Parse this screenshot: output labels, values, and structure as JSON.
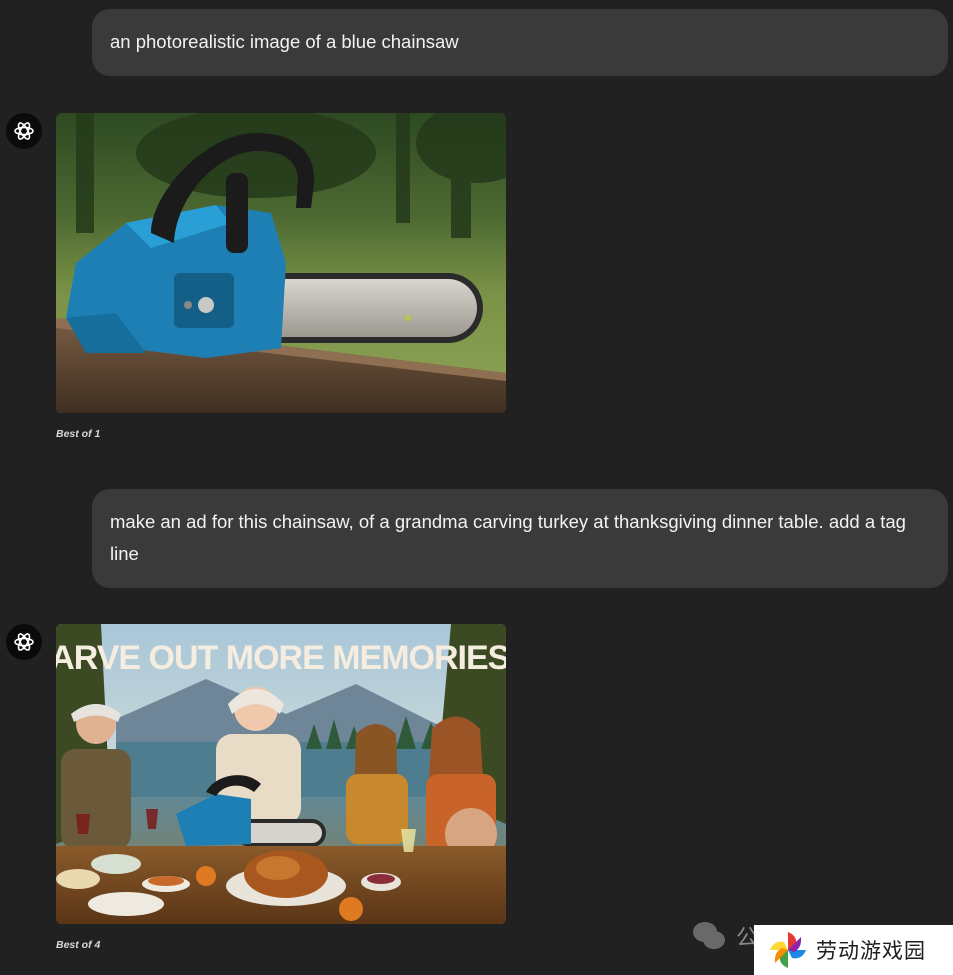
{
  "conversation": {
    "messages": [
      {
        "role": "user",
        "text": "an photorealistic image of a blue chainsaw"
      },
      {
        "role": "assistant",
        "image_icon": "blue-chainsaw-photo",
        "caption": "Best of 1"
      },
      {
        "role": "user",
        "text": "make an ad for this chainsaw, of a grandma carving turkey at thanksgiving dinner table. add a tag line"
      },
      {
        "role": "assistant",
        "image_icon": "thanksgiving-chainsaw-ad",
        "image_tagline": "CARVE OUT MORE MEMORIES",
        "caption": "Best of 4"
      }
    ]
  },
  "watermark": {
    "prefix": "公",
    "brand": "劳动游戏园",
    "icons": [
      "wechat-icon",
      "pinwheel-logo"
    ]
  },
  "colors": {
    "background": "#212121",
    "user_bubble": "#3a3a3a",
    "text": "#f2f2f2",
    "chainsaw_blue": "#1d7fb3",
    "tagline": "#f4ede0"
  }
}
